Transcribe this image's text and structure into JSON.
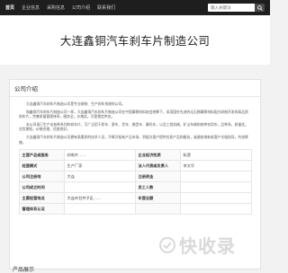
{
  "nav": {
    "items": [
      {
        "label": "首页",
        "active": true
      },
      {
        "label": "企业信息",
        "active": false
      },
      {
        "label": "采购信息",
        "active": false
      },
      {
        "label": "公司介绍",
        "active": false
      },
      {
        "label": "联系我们",
        "active": false
      }
    ]
  },
  "search": {
    "placeholder": "输入关键词",
    "icon": "search-icon"
  },
  "header": {
    "title": "大连鑫铜汽车刹车片制造公司"
  },
  "section": {
    "title": "公司介绍"
  },
  "intro": {
    "paragraphs": [
      "大连鑫铜汽车刹车片制造公司是专业研制、生产刹车系统的公司。",
      "和鑫铜汽车刹车片制造公司一样，大连鑫铜汽车刹车片制造公司在中国摩擦材料协会统筹下，采用国外先进的无石棉摩擦材料配方研制开发的高品质刹车片，完善质量管理体系，服务全，价格实，可靠稳定供应。",
      "本公司现已生产出各种系列的刹车片，可广泛用于轿车、客车、货车、微型车、摩托车，以及工程机械，矿山车辆和各种农用车，品种多，质量优，交货期短，价格合理，信誉良好。",
      "大连鑫铜汽车刹车片制造公司拥有高素质的技术人员，不断开拓新产品市场，积极为客户提供优质产品和服务，诚邀各地新老客户光临指导，共创辉煌。"
    ]
  },
  "info_table": {
    "rows": [
      [
        {
          "k": "主营产品或服务",
          "v": "刹车片……"
        },
        {
          "k": "企业经济性质",
          "v": "私营"
        }
      ],
      [
        {
          "k": "经营模式",
          "v": "生产厂家"
        },
        {
          "k": "法人代表或负责人",
          "v": "李文华"
        }
      ],
      [
        {
          "k": "公司注册地",
          "v": "大连"
        },
        {
          "k": "注册资金",
          "v": ""
        }
      ],
      [
        {
          "k": "公司成立时间",
          "v": ""
        },
        {
          "k": "员工人数",
          "v": ""
        }
      ],
      [
        {
          "k": "主要经营地点",
          "v": "大连市甘井子区……"
        },
        {
          "k": "年营业额",
          "v": ""
        }
      ],
      [
        {
          "k": "管理体系认证",
          "v": ""
        },
        {
          "k": "",
          "v": ""
        }
      ]
    ]
  },
  "footer": {
    "next_section_title": "产品展示"
  },
  "watermark": {
    "text": "快收录"
  }
}
